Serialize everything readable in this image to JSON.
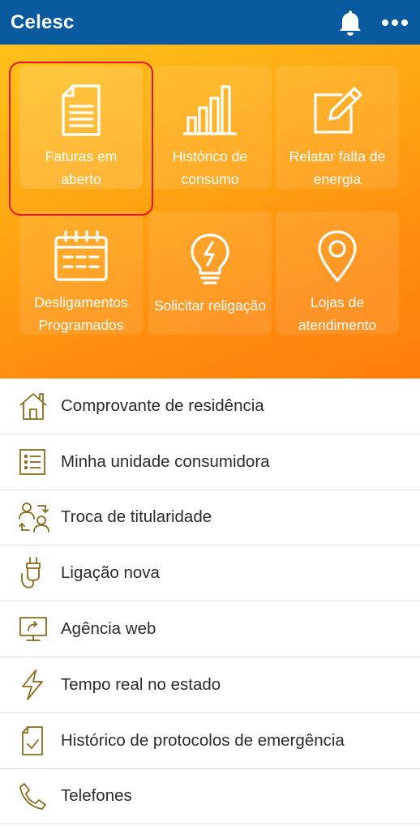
{
  "app": {
    "title": "Celesc"
  },
  "header": {
    "bell_icon": "bell-icon",
    "menu_icon": "more-dots-icon"
  },
  "tiles": [
    {
      "label": "Faturas em aberto",
      "icon": "invoice-icon"
    },
    {
      "label": "Histórico de consumo",
      "icon": "bar-chart-icon"
    },
    {
      "label": "Relatar falta de energia",
      "icon": "edit-icon"
    },
    {
      "label": "Desligamentos Programados",
      "icon": "calendar-icon"
    },
    {
      "label": "Solicitar religação",
      "icon": "lightbulb-icon"
    },
    {
      "label": "Lojas de atendimento",
      "icon": "location-pin-icon"
    }
  ],
  "menu": [
    {
      "label": "Comprovante de residência",
      "icon": "house-icon"
    },
    {
      "label": "Minha unidade consumidora",
      "icon": "list-icon"
    },
    {
      "label": "Troca de titularidade",
      "icon": "swap-users-icon"
    },
    {
      "label": "Ligação nova",
      "icon": "plug-icon"
    },
    {
      "label": "Agência web",
      "icon": "monitor-icon"
    },
    {
      "label": "Tempo real no estado",
      "icon": "lightning-icon"
    },
    {
      "label": "Histórico de protocolos de emergência",
      "icon": "document-check-icon"
    },
    {
      "label": "Telefones",
      "icon": "phone-icon"
    }
  ],
  "colors": {
    "header": "#0a5aa0",
    "accent_orange": "#ff9a10",
    "icon_gold": "#b8860b",
    "highlight_red": "#e8152a"
  }
}
